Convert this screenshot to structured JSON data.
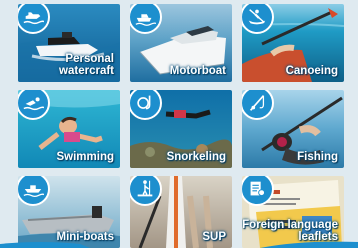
{
  "tiles": [
    {
      "label": "Personal\nwatercraft",
      "icon": "jetski-icon"
    },
    {
      "label": "Motorboat",
      "icon": "motorboat-icon"
    },
    {
      "label": "Canoeing",
      "icon": "canoe-icon"
    },
    {
      "label": "Swimming",
      "icon": "swimmer-icon"
    },
    {
      "label": "Snorkeling",
      "icon": "snorkel-icon"
    },
    {
      "label": "Fishing",
      "icon": "fishing-icon"
    },
    {
      "label": "Mini-boats",
      "icon": "miniboat-icon"
    },
    {
      "label": "SUP",
      "icon": "sup-icon"
    },
    {
      "label": "Foreign language\nleaflets",
      "icon": "leaflet-icon"
    }
  ],
  "colors": {
    "badge": "#1d8fce",
    "background": "#dfeaf0",
    "accent_orange": "#f2a23a"
  }
}
